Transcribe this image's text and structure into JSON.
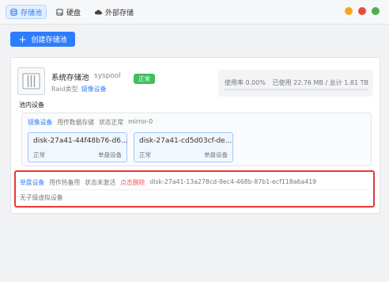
{
  "tabs": [
    {
      "label": "存储池",
      "icon": "database-icon",
      "active": true
    },
    {
      "label": "硬盘",
      "icon": "hard-disk-icon",
      "active": false
    },
    {
      "label": "外部存储",
      "icon": "cloud-icon",
      "active": false
    }
  ],
  "window_controls": {
    "colors": [
      "#f5a623",
      "#e74c3c",
      "#4caf50"
    ]
  },
  "create_button": {
    "label": "创建存储池",
    "icon": "plus-icon"
  },
  "pool": {
    "icon": "storage-pool-icon",
    "name": "系统存储池",
    "id": "syspool",
    "type_label": "Raid类型",
    "type_value": "镜像设备",
    "status": "正常",
    "usage_rate_label": "使用率 0.00%",
    "usage_detail": "已使用 22.76 MB / 总计 1.81 TB",
    "usage_fraction": 0.0
  },
  "devices_section": {
    "title": "池内设备",
    "mirror": {
      "device_type": "镜像设备",
      "purpose": "用作数据存储",
      "status": "状态正常",
      "name": "mirror-0",
      "disks": [
        {
          "name": "disk-27a41-44f48b76-d6...",
          "state": "正常",
          "role": "单盘设备"
        },
        {
          "name": "disk-27a41-cd5d03cf-de...",
          "state": "正常",
          "role": "单盘设备"
        }
      ]
    },
    "spare": {
      "device_type": "单盘设备",
      "purpose": "用作热备用",
      "status": "状态未激活",
      "action": "点击删除",
      "disk_name": "disk-27a41-13a278cd-9ec4-468b-87b1-ecf118a6a419",
      "children_note": "无子级虚拟设备"
    }
  },
  "colors": {
    "accent": "#2f7dff",
    "success": "#3fbf5f",
    "danger": "#ff4d4f",
    "highlight_border": "#e53935"
  }
}
